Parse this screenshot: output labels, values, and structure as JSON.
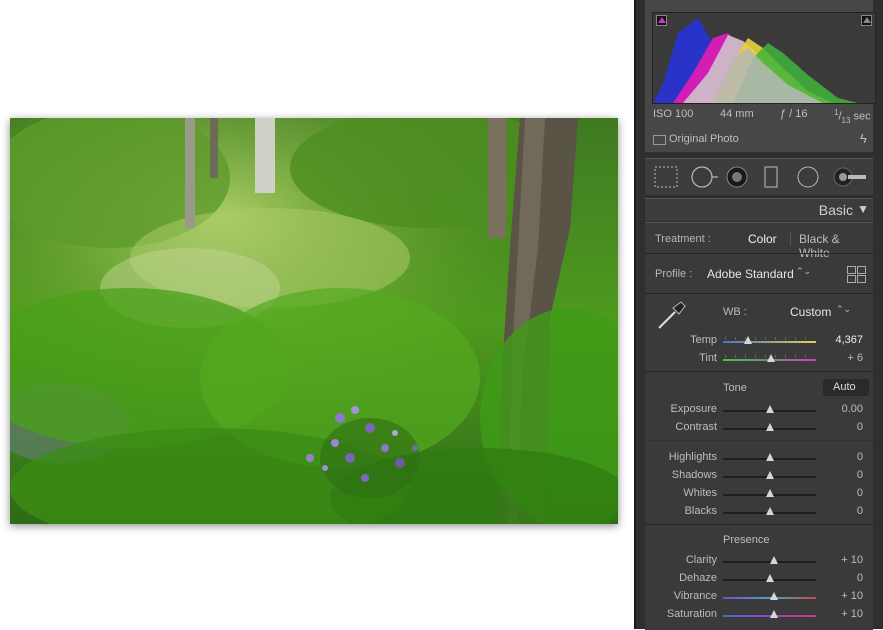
{
  "histogram": {
    "exif": {
      "iso": "ISO 100",
      "focal": "44 mm",
      "aperture": "ƒ / 16",
      "shutter_num": "1",
      "shutter_den": "13",
      "shutter_unit": "sec"
    },
    "original_photo_label": "Original Photo"
  },
  "tool_icons": [
    "crop-overlay-icon",
    "spot-removal-icon",
    "red-eye-icon",
    "graduated-filter-icon",
    "radial-filter-icon",
    "adjustment-brush-icon"
  ],
  "basic": {
    "title": "Basic",
    "treatment_label": "Treatment :",
    "treatment_color": "Color",
    "treatment_bw": "Black & White",
    "profile_label": "Profile :",
    "profile_value": "Adobe Standard",
    "profile_chevron": "⌃⌄",
    "wb_label": "WB :",
    "wb_value": "Custom",
    "wb_chevron": "⌃⌄",
    "tone_label": "Tone",
    "auto_label": "Auto",
    "presence_label": "Presence"
  },
  "sliders": {
    "temp": {
      "label": "Temp",
      "value": "4,367",
      "level": 0.27
    },
    "tint": {
      "label": "Tint",
      "value": "+ 6",
      "level": 0.52
    },
    "exposure": {
      "label": "Exposure",
      "value": "0.00",
      "level": 0.5
    },
    "contrast": {
      "label": "Contrast",
      "value": "0",
      "level": 0.5
    },
    "highlights": {
      "label": "Highlights",
      "value": "0",
      "level": 0.5
    },
    "shadows": {
      "label": "Shadows",
      "value": "0",
      "level": 0.5
    },
    "whites": {
      "label": "Whites",
      "value": "0",
      "level": 0.5
    },
    "blacks": {
      "label": "Blacks",
      "value": "0",
      "level": 0.5
    },
    "clarity": {
      "label": "Clarity",
      "value": "+ 10",
      "level": 0.55
    },
    "dehaze": {
      "label": "Dehaze",
      "value": "0",
      "level": 0.5
    },
    "vibrance": {
      "label": "Vibrance",
      "value": "+ 10",
      "level": 0.55
    },
    "saturation": {
      "label": "Saturation",
      "value": "+ 10",
      "level": 0.55
    }
  }
}
